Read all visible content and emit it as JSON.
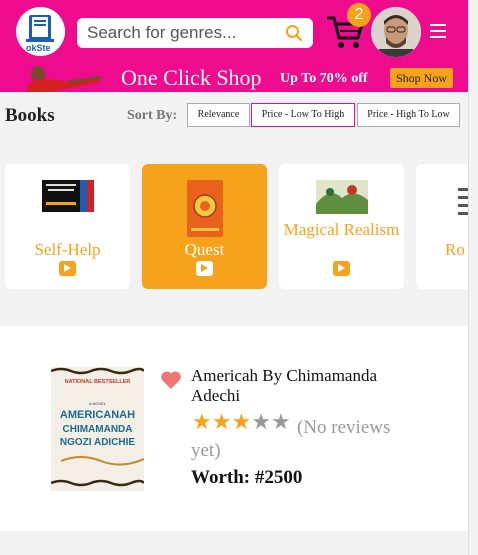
{
  "header": {
    "logo_text": "okSte",
    "search_placeholder": "Search for genres...",
    "cart_count": "2"
  },
  "promo": {
    "title": "One Click Shop",
    "subtitle": "Up To 70% off",
    "button": "Shop Now"
  },
  "books_title": "Books",
  "sort": {
    "label": "Sort By:",
    "options": [
      "Relevance",
      "Price - Low To High",
      "Price - High To Low"
    ],
    "active": "Price - Low To High"
  },
  "genres": [
    {
      "label": "Self-Help",
      "active": false
    },
    {
      "label": "Quest",
      "active": true
    },
    {
      "label": "Magical Realism",
      "active": false
    },
    {
      "label": "Ro",
      "active": false
    }
  ],
  "product": {
    "title": "Americah By Chimamanda Adechi",
    "rating": 3,
    "max_rating": 5,
    "reviews": "(No reviews yet)",
    "worth": "Worth: #2500",
    "cover": {
      "badge": "NATIONAL BESTSELLER",
      "subtitle": "A NOVEL",
      "title": "AMERICANAH",
      "author_1": "CHIMAMANDA",
      "author_2": "NGOZI ADICHIE"
    }
  },
  "colors": {
    "brand_pink": "#ee0b8e",
    "accent_orange": "#f7a21b"
  }
}
